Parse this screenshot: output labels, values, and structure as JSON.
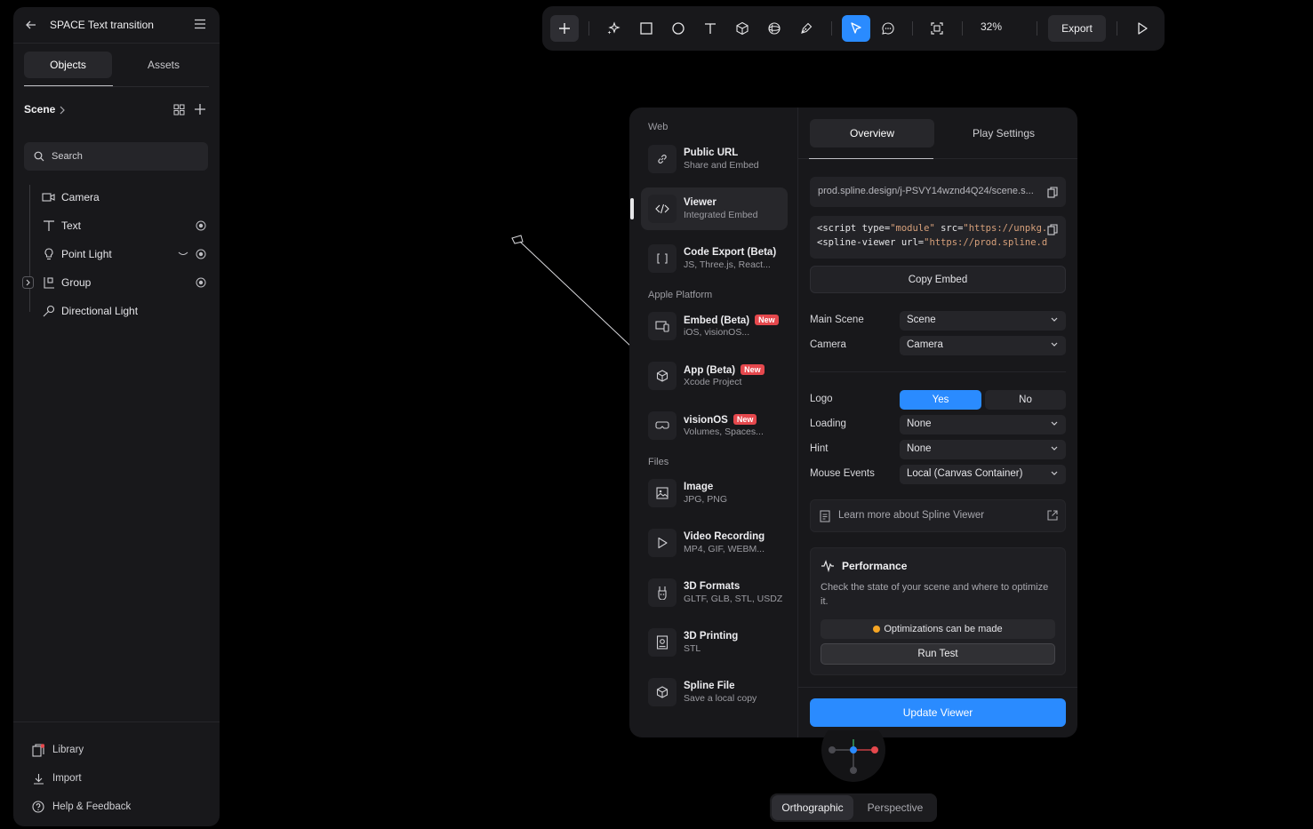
{
  "project": {
    "title": "SPACE Text transition"
  },
  "left_panel": {
    "tabs": [
      {
        "label": "Objects"
      },
      {
        "label": "Assets"
      }
    ],
    "scene_label": "Scene",
    "search_placeholder": "Search",
    "tree": [
      {
        "label": "Camera",
        "icon": "camera-icon"
      },
      {
        "label": "Text",
        "icon": "text-icon"
      },
      {
        "label": "Point Light",
        "icon": "bulb-icon"
      },
      {
        "label": "Group",
        "icon": "group-icon"
      },
      {
        "label": "Directional Light",
        "icon": "directional-light-icon"
      }
    ],
    "footer": [
      {
        "label": "Library",
        "icon": "library-icon"
      },
      {
        "label": "Import",
        "icon": "import-icon"
      },
      {
        "label": "Help & Feedback",
        "icon": "help-icon"
      }
    ]
  },
  "toolbar": {
    "zoom": "32%",
    "export_label": "Export",
    "tools": [
      "add",
      "ai-sparkle",
      "rectangle",
      "ellipse",
      "text",
      "cube",
      "sphere",
      "pen",
      "select",
      "comment",
      "frame",
      "play"
    ],
    "accent": "#2a8bff"
  },
  "export_modal": {
    "sections": {
      "web": "Web",
      "apple": "Apple Platform",
      "files": "Files"
    },
    "options": [
      {
        "title": "Public URL",
        "sub": "Share and Embed",
        "icon": "link-icon"
      },
      {
        "title": "Viewer",
        "sub": "Integrated Embed",
        "icon": "code-icon"
      },
      {
        "title": "Code Export (Beta)",
        "sub": "JS, Three.js, React...",
        "icon": "brackets-icon"
      },
      {
        "title": "Embed (Beta)",
        "sub": "iOS, visionOS...",
        "badge": "New",
        "icon": "devices-icon"
      },
      {
        "title": "App (Beta)",
        "sub": "Xcode Project",
        "badge": "New",
        "icon": "box-icon"
      },
      {
        "title": "visionOS",
        "sub": "Volumes, Spaces...",
        "badge": "New",
        "icon": "vision-pro-icon"
      },
      {
        "title": "Image",
        "sub": "JPG, PNG",
        "icon": "image-icon"
      },
      {
        "title": "Video Recording",
        "sub": "MP4, GIF, WEBM...",
        "icon": "play-icon"
      },
      {
        "title": "3D Formats",
        "sub": "GLTF, GLB, STL, USDZ",
        "icon": "rabbit-icon"
      },
      {
        "title": "3D Printing",
        "sub": "STL",
        "icon": "printer-icon"
      },
      {
        "title": "Spline File",
        "sub": "Save a local copy",
        "icon": "cube-file-icon"
      }
    ],
    "tabs": [
      {
        "label": "Overview"
      },
      {
        "label": "Play Settings"
      }
    ],
    "url": "prod.spline.design/j-PSVY14wznd4Q24/scene.s...",
    "code": {
      "line1_tag": "<script",
      "line1_attr1": " type=",
      "line1_val1": "\"module\"",
      "line1_attr2": " src=",
      "line1_val2": "\"https://unpkg.",
      "line2_tag": "<spline-viewer",
      "line2_attr": " url=",
      "line2_val": "\"https://prod.spline.d"
    },
    "copy_embed": "Copy Embed",
    "fields": {
      "main_scene": {
        "label": "Main Scene",
        "value": "Scene"
      },
      "camera": {
        "label": "Camera",
        "value": "Camera"
      },
      "logo": {
        "label": "Logo",
        "yes": "Yes",
        "no": "No",
        "selected": "Yes"
      },
      "loading": {
        "label": "Loading",
        "value": "None"
      },
      "hint": {
        "label": "Hint",
        "value": "None"
      },
      "mouse_events": {
        "label": "Mouse Events",
        "value": "Local (Canvas Container)"
      }
    },
    "learn_more": "Learn more about Spline Viewer",
    "performance": {
      "title": "Performance",
      "description": "Check the state of your scene and where to optimize it.",
      "status": "Optimizations can be made",
      "status_color": "#f5a524",
      "run_test": "Run Test"
    },
    "update_button": "Update Viewer"
  },
  "view_toggle": [
    {
      "label": "Orthographic",
      "active": true
    },
    {
      "label": "Perspective",
      "active": false
    }
  ]
}
